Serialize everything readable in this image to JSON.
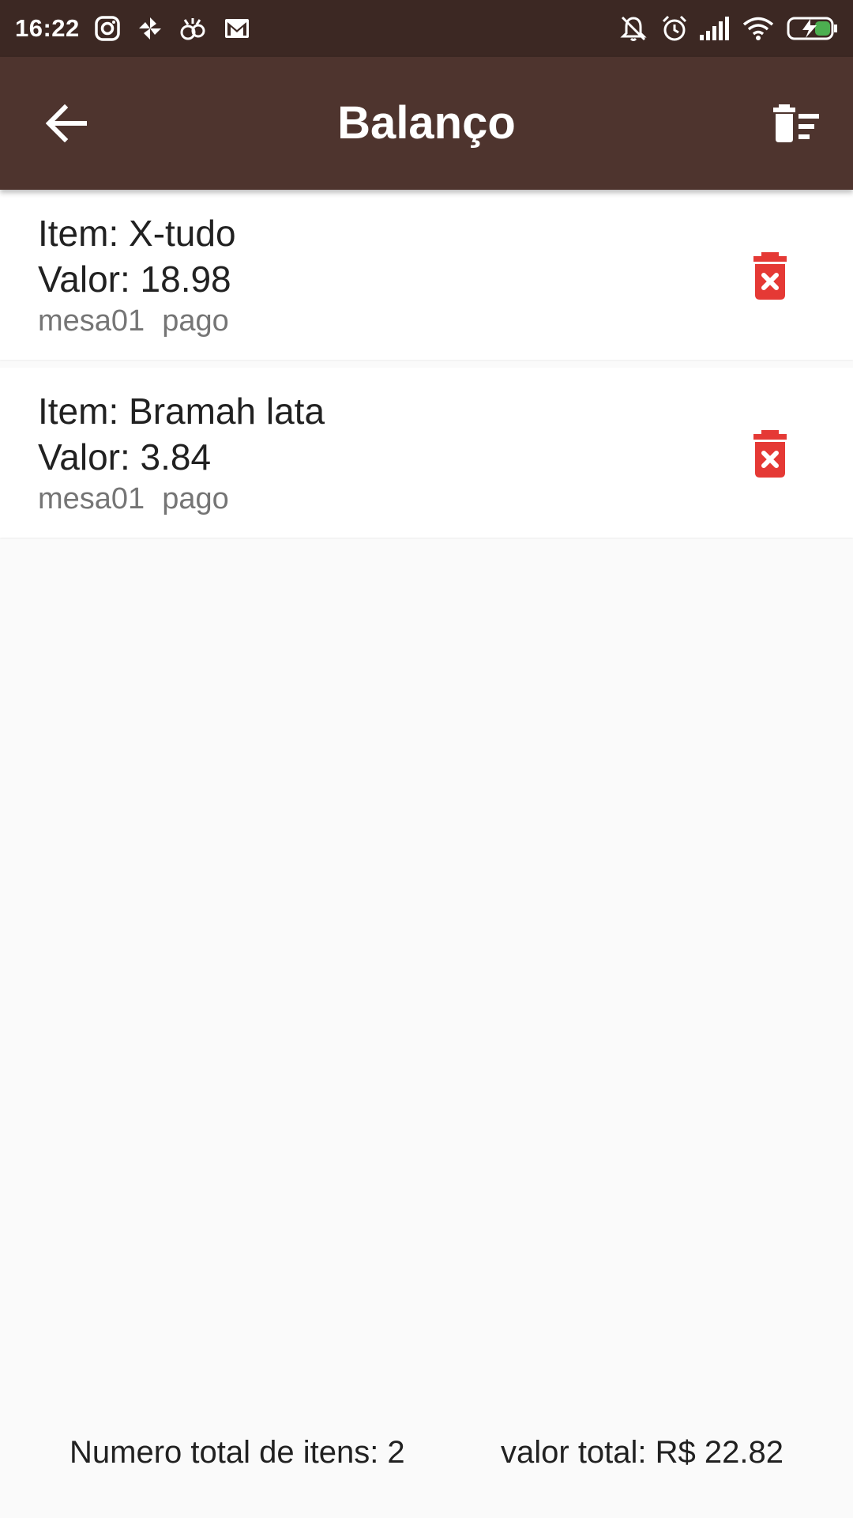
{
  "status_bar": {
    "time": "16:22",
    "left_icons": [
      "instagram-icon",
      "pinwheel-icon",
      "notification-app-icon",
      "gmail-icon"
    ],
    "right_icons": [
      "muted-bell-icon",
      "alarm-icon",
      "signal-icon",
      "wifi-icon",
      "battery-charging-icon"
    ]
  },
  "app_bar": {
    "title": "Balanço",
    "back_icon": "arrow-back-icon",
    "action_icon": "delete-sweep-icon",
    "background": "#4e342e"
  },
  "items": [
    {
      "title": "Item: X-tudo",
      "value": "Valor: 18.98",
      "table": "mesa01",
      "status": "pago",
      "delete_icon": "delete-forever-icon"
    },
    {
      "title": "Item: Bramah lata",
      "value": "Valor: 3.84",
      "table": "mesa01",
      "status": "pago",
      "delete_icon": "delete-forever-icon"
    }
  ],
  "footer": {
    "count_text": "Numero total de itens: 2",
    "total_text": "valor total: R$ 22.82"
  },
  "colors": {
    "delete_red": "#e53935",
    "status_bar": "#3c2823"
  }
}
